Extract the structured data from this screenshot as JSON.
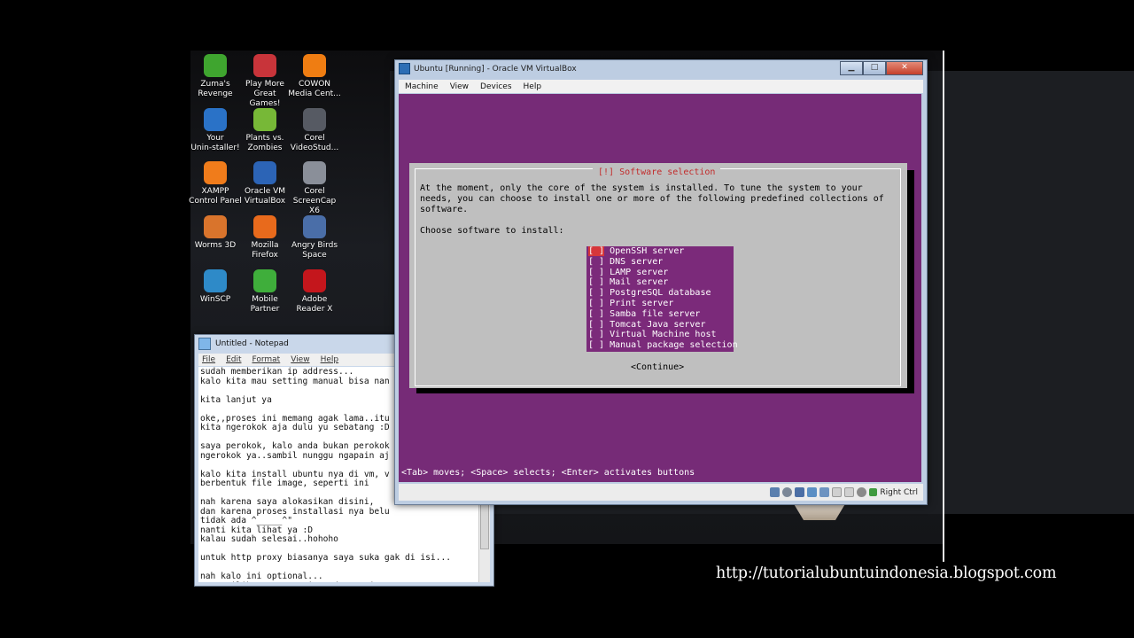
{
  "desktop_icons": [
    {
      "label_1": "Zuma's",
      "label_2": "Revenge",
      "icon": "zuma-icon",
      "color": "#3fa52f"
    },
    {
      "label_1": "Play More",
      "label_2": "Great Games!",
      "icon": "games-icon",
      "color": "#c8343a"
    },
    {
      "label_1": "COWON",
      "label_2": "Media Cent...",
      "icon": "cowon-icon",
      "color": "#ef7d12"
    },
    {
      "label_1": "Your",
      "label_2": "Unin-staller!",
      "icon": "uninstaller-icon",
      "color": "#2a72c7"
    },
    {
      "label_1": "Plants vs.",
      "label_2": "Zombies",
      "icon": "plants-icon",
      "color": "#77b837"
    },
    {
      "label_1": "Corel",
      "label_2": "VideoStud...",
      "icon": "corel-video-icon",
      "color": "#565a63"
    },
    {
      "label_1": "XAMPP",
      "label_2": "Control Panel",
      "icon": "xampp-icon",
      "color": "#f07c1b"
    },
    {
      "label_1": "Oracle VM",
      "label_2": "VirtualBox",
      "icon": "virtualbox-icon",
      "color": "#2c64b6"
    },
    {
      "label_1": "Corel",
      "label_2": "ScreenCap X6",
      "icon": "screencap-icon",
      "color": "#8a8f99"
    },
    {
      "label_1": "Worms 3D",
      "label_2": "",
      "icon": "worms-icon",
      "color": "#d9742c"
    },
    {
      "label_1": "Mozilla",
      "label_2": "Firefox",
      "icon": "firefox-icon",
      "color": "#e86a1c"
    },
    {
      "label_1": "Angry Birds",
      "label_2": "Space",
      "icon": "angry-birds-icon",
      "color": "#4a6ea8"
    },
    {
      "label_1": "WinSCP",
      "label_2": "",
      "icon": "winscp-icon",
      "color": "#2e8ac8"
    },
    {
      "label_1": "Mobile",
      "label_2": "Partner",
      "icon": "mobile-partner-icon",
      "color": "#3fae3b"
    },
    {
      "label_1": "Adobe",
      "label_2": "Reader X",
      "icon": "adobe-reader-icon",
      "color": "#c4161c"
    }
  ],
  "notepad": {
    "title": "Untitled - Notepad",
    "menu": [
      "File",
      "Edit",
      "Format",
      "View",
      "Help"
    ],
    "lines": [
      "sudah memberikan ip address...",
      "kalo kita mau setting manual bisa nan",
      "",
      "kita lanjut ya",
      "",
      "oke,,proses ini memang agak lama..itu",
      "kita ngerokok aja dulu yu sebatang :D",
      "",
      "saya perokok, kalo anda bukan perokok",
      "ngerokok ya..sambil nunggu ngapain aj",
      "",
      "kalo kita install ubuntu nya di vm, v",
      "berbentuk file image, seperti ini",
      "",
      "nah karena saya alokasikan disini,",
      "dan karena proses installasi nya belu",
      "tidak ada ^_____^\"",
      "nanti kita lihat ya :D",
      "kalau sudah selesai..hohoho",
      "",
      "untuk http proxy biasanya saya suka gak di isi...",
      "",
      "nah kalo ini optional...",
      "saya pilih no automatic updates aja"
    ]
  },
  "vbox": {
    "title": "Ubuntu [Running] - Oracle VM VirtualBox",
    "menu": [
      "Machine",
      "View",
      "Devices",
      "Help"
    ],
    "status_hostkey": "Right Ctrl",
    "installer": {
      "dialog_title": "[!] Software selection",
      "paragraph": "At the moment, only the core of the system is installed. To tune the system to your\nneeds, you can choose to install one or more of the following predefined collections of\nsoftware.",
      "prompt": "Choose software to install:",
      "options": [
        {
          "box": "[ ]",
          "label": "OpenSSH server",
          "focused": true
        },
        {
          "box": "[ ]",
          "label": "DNS server"
        },
        {
          "box": "[ ]",
          "label": "LAMP server"
        },
        {
          "box": "[ ]",
          "label": "Mail server"
        },
        {
          "box": "[ ]",
          "label": "PostgreSQL database"
        },
        {
          "box": "[ ]",
          "label": "Print server"
        },
        {
          "box": "[ ]",
          "label": "Samba file server"
        },
        {
          "box": "[ ]",
          "label": "Tomcat Java server"
        },
        {
          "box": "[ ]",
          "label": "Virtual Machine host"
        },
        {
          "box": "[ ]",
          "label": "Manual package selection"
        }
      ],
      "continue": "<Continue>",
      "hint": "<Tab> moves; <Space> selects; <Enter> activates buttons"
    }
  },
  "watermark": "http://tutorialubuntuindonesia.blogspot.com",
  "colors": {
    "installer_bg": "#762b77",
    "dialog_bg": "#bfbfbf",
    "focus": "#d6363a"
  }
}
